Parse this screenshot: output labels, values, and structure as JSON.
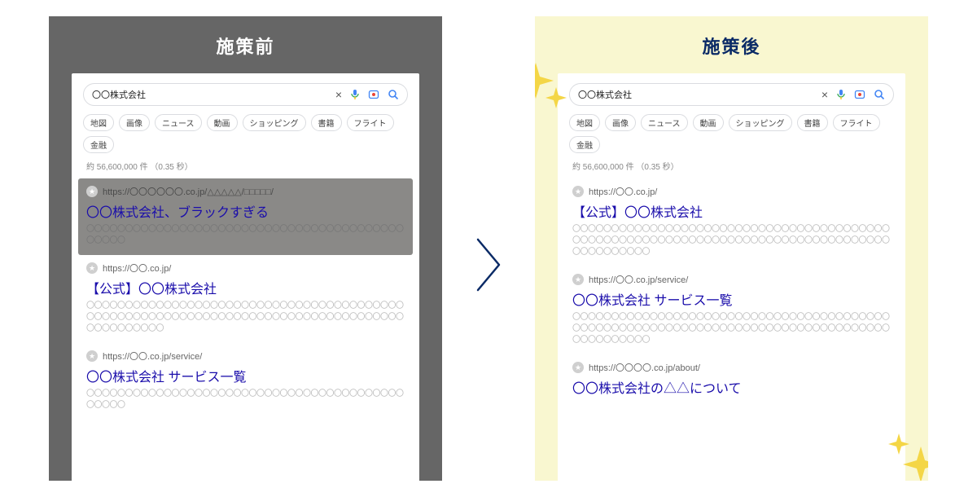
{
  "before": {
    "title": "施策前",
    "query": "〇〇株式会社",
    "tabs": [
      "地図",
      "画像",
      "ニュース",
      "動画",
      "ショッピング",
      "書籍",
      "フライト",
      "金融"
    ],
    "stats": "約 56,600,000 件 （0.35 秒）",
    "results": [
      {
        "url": "https://〇〇〇〇〇〇.co.jp/△△△△△/□□□□□/",
        "title": "〇〇株式会社、ブラックすぎる",
        "snippet": "〇〇〇〇〇〇〇〇〇〇〇〇〇〇〇〇〇〇〇〇〇〇〇〇〇〇〇〇〇〇〇〇〇〇〇〇〇〇〇〇〇〇〇〇〇〇",
        "highlight": true
      },
      {
        "url": "https://〇〇.co.jp/",
        "title": "【公式】〇〇株式会社",
        "snippet": "〇〇〇〇〇〇〇〇〇〇〇〇〇〇〇〇〇〇〇〇〇〇〇〇〇〇〇〇〇〇〇〇〇〇〇〇〇〇〇〇〇〇〇〇〇〇〇〇〇〇〇〇〇〇〇〇〇〇〇〇〇〇〇〇〇〇〇〇〇〇〇〇〇〇〇〇〇〇〇〇〇〇〇〇〇〇〇〇〇〇〇〇",
        "highlight": false
      },
      {
        "url": "https://〇〇.co.jp/service/",
        "title": "〇〇株式会社 サービス一覧",
        "snippet": "〇〇〇〇〇〇〇〇〇〇〇〇〇〇〇〇〇〇〇〇〇〇〇〇〇〇〇〇〇〇〇〇〇〇〇〇〇〇〇〇〇〇〇〇〇〇",
        "highlight": false
      }
    ]
  },
  "after": {
    "title": "施策後",
    "query": "〇〇株式会社",
    "tabs": [
      "地図",
      "画像",
      "ニュース",
      "動画",
      "ショッピング",
      "書籍",
      "フライト",
      "金融"
    ],
    "stats": "約 56,600,000 件 （0.35 秒）",
    "results": [
      {
        "url": "https://〇〇.co.jp/",
        "title": "【公式】〇〇株式会社",
        "snippet": "〇〇〇〇〇〇〇〇〇〇〇〇〇〇〇〇〇〇〇〇〇〇〇〇〇〇〇〇〇〇〇〇〇〇〇〇〇〇〇〇〇〇〇〇〇〇〇〇〇〇〇〇〇〇〇〇〇〇〇〇〇〇〇〇〇〇〇〇〇〇〇〇〇〇〇〇〇〇〇〇〇〇〇〇〇〇〇〇〇〇〇〇"
      },
      {
        "url": "https://〇〇.co.jp/service/",
        "title": "〇〇株式会社 サービス一覧",
        "snippet": "〇〇〇〇〇〇〇〇〇〇〇〇〇〇〇〇〇〇〇〇〇〇〇〇〇〇〇〇〇〇〇〇〇〇〇〇〇〇〇〇〇〇〇〇〇〇〇〇〇〇〇〇〇〇〇〇〇〇〇〇〇〇〇〇〇〇〇〇〇〇〇〇〇〇〇〇〇〇〇〇〇〇〇〇〇〇〇〇〇〇〇〇"
      },
      {
        "url": "https://〇〇〇〇.co.jp/about/",
        "title": "〇〇株式会社の△△について",
        "snippet": ""
      }
    ]
  }
}
